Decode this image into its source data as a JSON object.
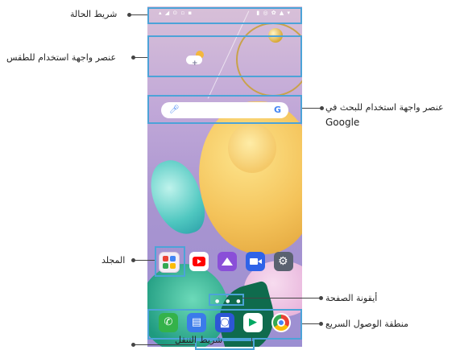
{
  "callouts": {
    "status_bar": "شريط الحالة",
    "weather_widget": "عنصر واجهة استخدام للطقس",
    "google_search_widget_line1": "عنصر واجهة استخدام للبحث في",
    "google_search_widget_line2": "Google",
    "folder": "المجلد",
    "page_icon": "أيقونة الصفحة",
    "quick_access": "منطقة الوصول السريع",
    "nav_bar": "شريط التنقل"
  },
  "icons": {
    "weather": "cloud-sun-icon",
    "mic": "microphone-icon",
    "google": "google-g-icon",
    "folder": "folder-icon",
    "youtube": "youtube-icon",
    "gallery": "gallery-icon",
    "video": "video-icon",
    "settings": "gear-icon",
    "phone": "phone-icon",
    "messages": "message-icon",
    "camera": "camera-icon",
    "play_store": "play-store-icon",
    "chrome": "chrome-icon"
  },
  "colors": {
    "highlight": "#4ca3d8",
    "callout_line": "#444444"
  }
}
